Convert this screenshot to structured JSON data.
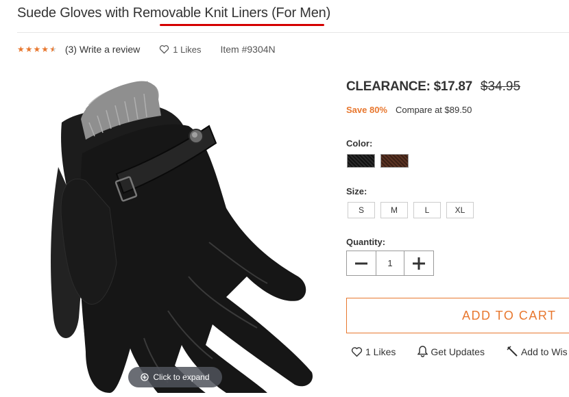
{
  "product": {
    "title": "Suede Gloves with Removable Knit Liners (For Men)",
    "rating_stars": 4.5,
    "review_link": "(3) Write a review",
    "likes": "1 Likes",
    "item_number": "Item #9304N"
  },
  "pricing": {
    "clearance": "CLEARANCE: $17.87",
    "original": "$34.95",
    "save": "Save 80%",
    "compare": "Compare at $89.50"
  },
  "options": {
    "color_label": "Color:",
    "colors": [
      "black",
      "brown"
    ],
    "size_label": "Size:",
    "sizes": [
      "S",
      "M",
      "L",
      "XL"
    ],
    "quantity_label": "Quantity:",
    "quantity": "1"
  },
  "image": {
    "expand_label": "Click to expand"
  },
  "buttons": {
    "add_to_cart": "ADD TO CART"
  },
  "actions": {
    "likes": "1 Likes",
    "updates": "Get Updates",
    "wishlist": "Add to Wis"
  },
  "colors": {
    "accent": "#e8772e",
    "underline": "#d40000"
  }
}
